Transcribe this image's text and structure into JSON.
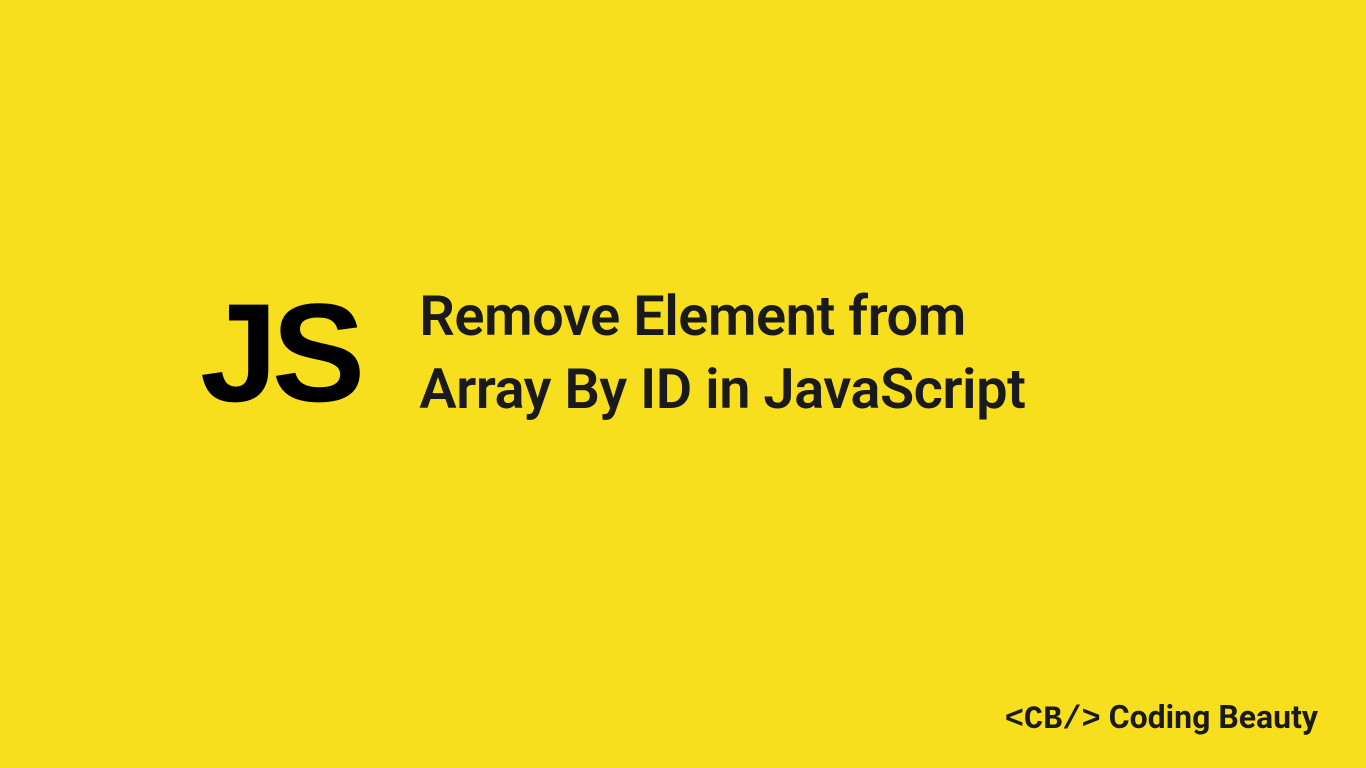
{
  "badge": {
    "text": "JS"
  },
  "title": {
    "line1": "Remove Element from",
    "line2": "Array By ID in JavaScript"
  },
  "footer": {
    "tag": "<CB/>",
    "name": "Coding Beauty"
  }
}
